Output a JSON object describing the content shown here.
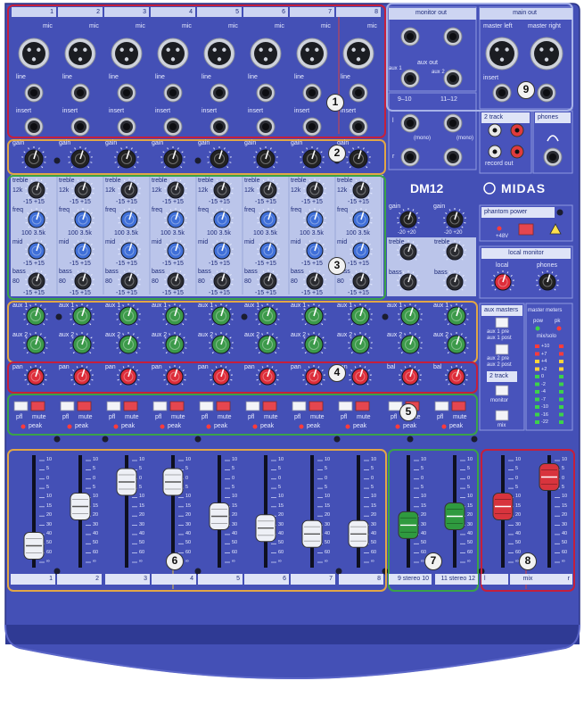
{
  "mixer": {
    "model": "DM12",
    "brand": "MIDAS",
    "channel_numbers": [
      "1",
      "2",
      "3",
      "4",
      "5",
      "6",
      "7",
      "8"
    ],
    "connector_labels": {
      "mic": "mic",
      "line": "line",
      "insert": "insert"
    },
    "knob_labels": {
      "gain": "gain",
      "treble": "treble",
      "freq": "freq",
      "mid": "mid",
      "bass": "bass",
      "aux1": "aux 1",
      "aux2": "aux 2",
      "pan": "pan",
      "bal": "bal",
      "pfl": "pfl",
      "mute": "mute",
      "peak": "peak"
    },
    "eq_values": {
      "treble_freq": "12k",
      "bass_freq": "80",
      "freq_low": "100",
      "freq_high": "8k",
      "minus": "-15",
      "plus": "+15",
      "gain_min": "-20",
      "gain_max": "+20",
      "mid_freq_hi": "3.5k"
    },
    "stereo_labels": {
      "mono": "(mono)",
      "ch9_10": "9–10",
      "ch11_12": "11–12",
      "l": "l",
      "r": "r"
    }
  },
  "master": {
    "monitor_out": "monitor out",
    "aux_out": "aux out",
    "aux_1": "aux 1",
    "aux_2": "aux 2",
    "main_out": "main out",
    "master_left": "master left",
    "master_right": "master right",
    "insert": "insert",
    "two_track": "2 track",
    "record_out": "record out",
    "phones": "phones",
    "phantom_power": "phantom power",
    "plus48v": "+48V",
    "local_monitor": "local monitor",
    "local": "local",
    "aux_masters": "aux masters",
    "aux1_pre": "aux 1 pre",
    "aux1_post": "aux 1 post",
    "aux2_pre": "aux 2 pre",
    "aux2_post": "aux 2 post",
    "monitor": "monitor",
    "mix": "mix",
    "master_meters": "master meters",
    "pow": "pow",
    "pk": "pk",
    "mix_solo": "mix/solo",
    "meter_scale": [
      "+10",
      "+7",
      "+4",
      "+2",
      "0",
      "-2",
      "-4",
      "-7",
      "-10",
      "-16",
      "-22"
    ]
  },
  "faders": {
    "scale": [
      "10",
      "5",
      "0",
      "5",
      "10",
      "15",
      "20",
      "30",
      "40",
      "50",
      "60",
      "∞"
    ],
    "labels": [
      "1",
      "2",
      "3",
      "4",
      "5",
      "6",
      "7",
      "8",
      "9 stereo 10",
      "11 stereo 12",
      "l",
      "mix",
      "r"
    ],
    "levels": [
      0.15,
      0.55,
      0.8,
      0.8,
      0.45,
      0.33,
      0.27,
      0.27,
      0.36,
      0.45,
      0.55,
      0.85
    ]
  },
  "callouts": [
    "1",
    "2",
    "3",
    "4",
    "5",
    "6",
    "7",
    "8",
    "9"
  ],
  "colors": {
    "panel": "#4450b6",
    "panel_dark": "#2f3a94",
    "strip_light": "#c9d2f0",
    "outline_red": "#c51f3c",
    "outline_orange": "#e2a646",
    "outline_green": "#3aa348",
    "knob_blue": "#3f6fd8",
    "knob_green": "#3c9a4a",
    "knob_red": "#dd2d3a",
    "knob_black": "#222"
  }
}
